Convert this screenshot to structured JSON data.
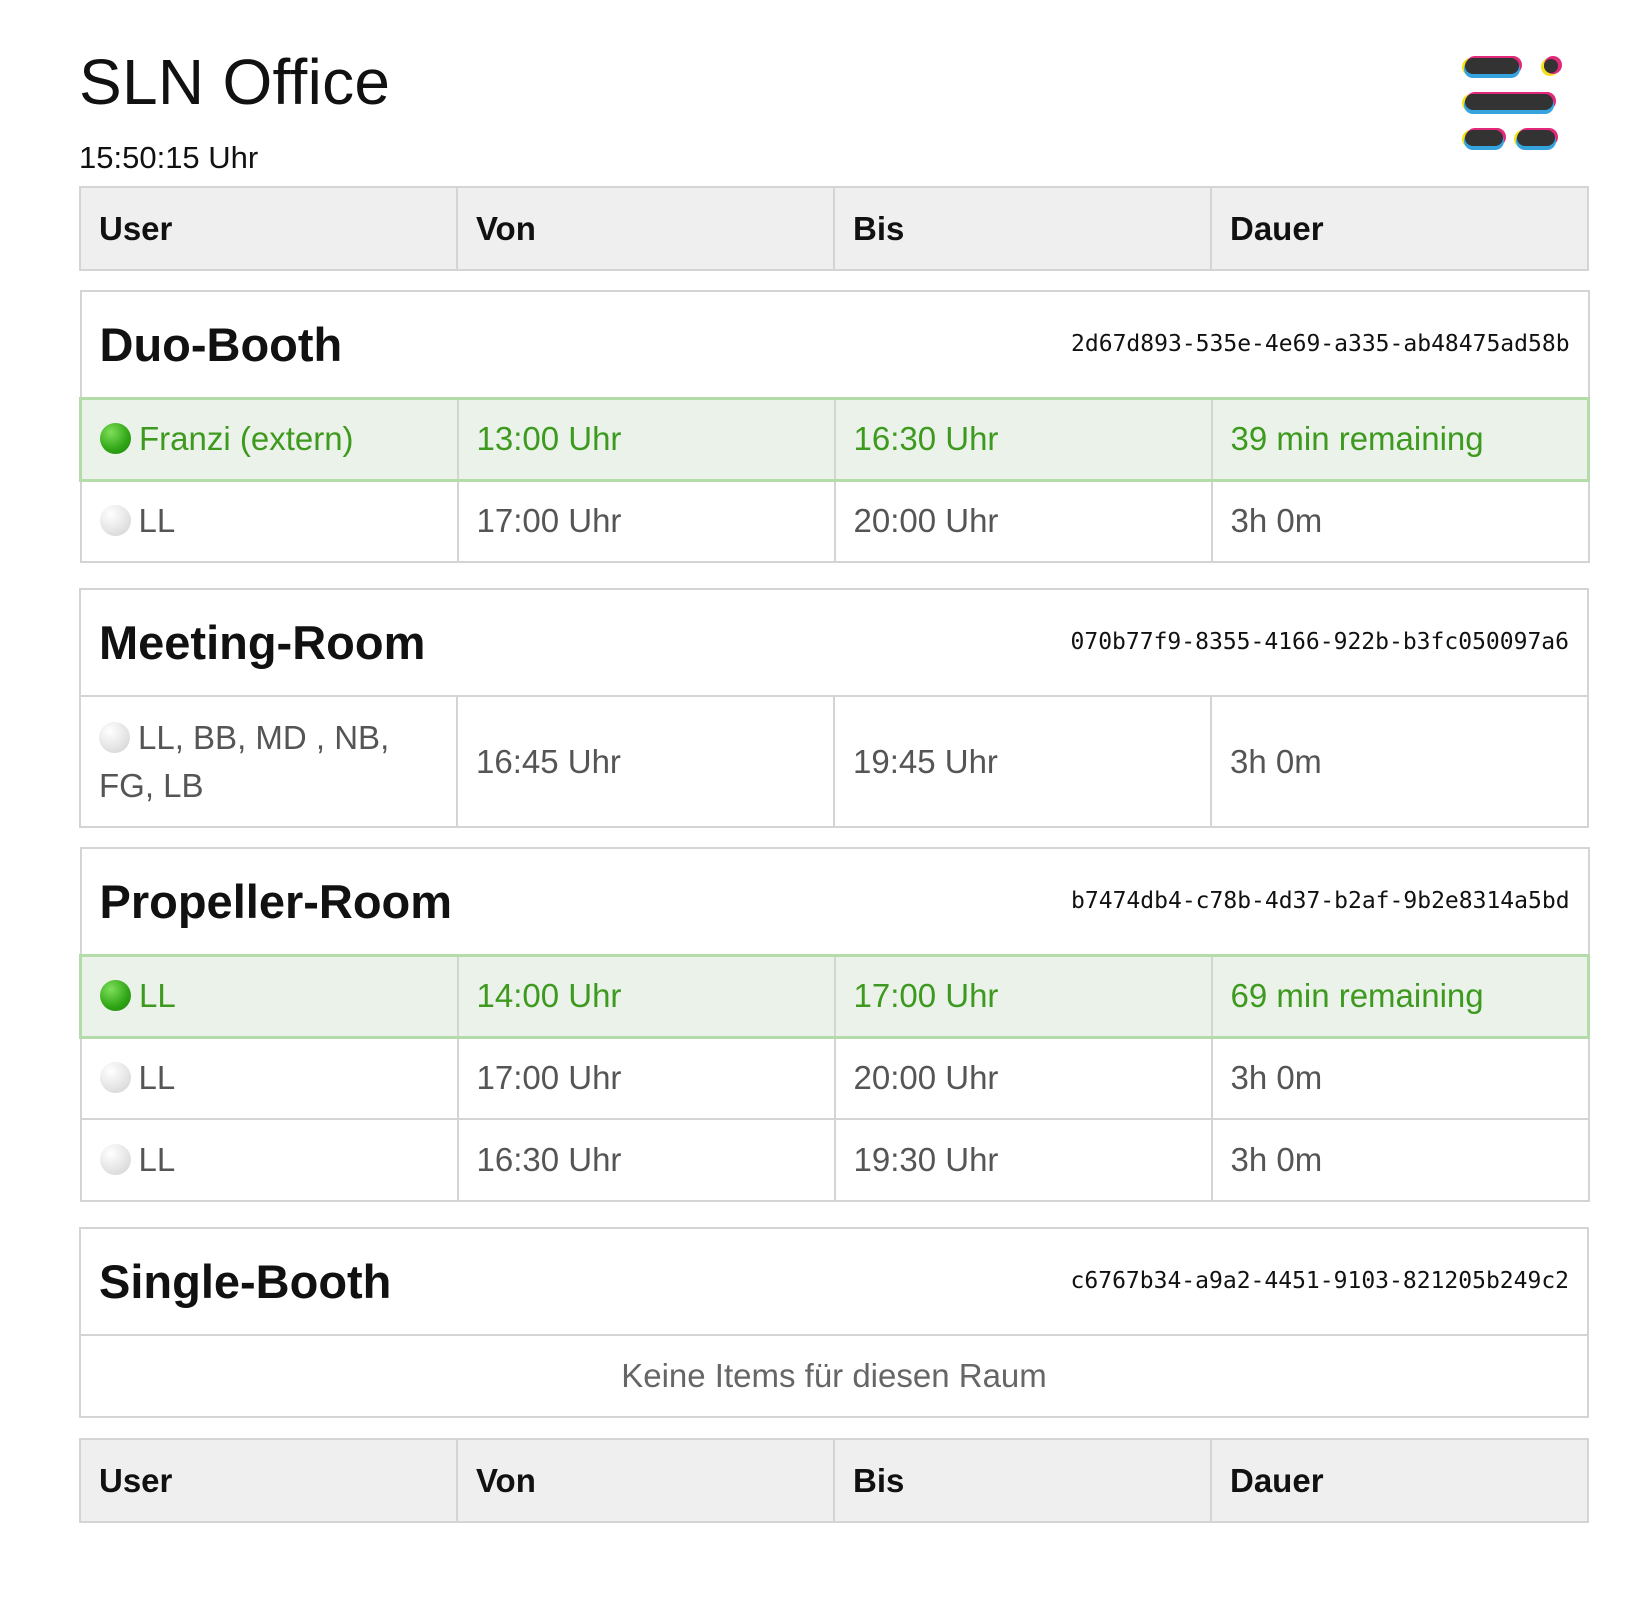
{
  "app": {
    "title": "SLN Office",
    "clock": "15:50:15 Uhr"
  },
  "logo": {
    "icon": "sln-logo-icon"
  },
  "columns": [
    "User",
    "Von",
    "Bis",
    "Dauer"
  ],
  "colors": {
    "active": "#3d9a1f",
    "active_bg": "#ebf2ea",
    "active_border": "#b4dcab"
  },
  "rooms": [
    {
      "name": "Duo-Booth",
      "id": "2d67d893-535e-4e69-a335-ab48475ad58b",
      "bookings": [
        {
          "status": "active",
          "user": "Franzi (extern)",
          "from": "13:00 Uhr",
          "to": "16:30 Uhr",
          "duration": "39 min remaining"
        },
        {
          "status": "upcoming",
          "user": "LL",
          "from": "17:00 Uhr",
          "to": "20:00 Uhr",
          "duration": "3h 0m"
        }
      ]
    },
    {
      "name": "Meeting-Room",
      "id": "070b77f9-8355-4166-922b-b3fc050097a6",
      "bookings": [
        {
          "status": "upcoming",
          "user": "LL, BB, MD , NB, FG, LB",
          "from": "16:45 Uhr",
          "to": "19:45 Uhr",
          "duration": "3h 0m"
        }
      ]
    },
    {
      "name": "Propeller-Room",
      "id": "b7474db4-c78b-4d37-b2af-9b2e8314a5bd",
      "bookings": [
        {
          "status": "active",
          "user": "LL",
          "from": "14:00 Uhr",
          "to": "17:00 Uhr",
          "duration": "69 min remaining"
        },
        {
          "status": "upcoming",
          "user": "LL",
          "from": "17:00 Uhr",
          "to": "20:00 Uhr",
          "duration": "3h 0m"
        },
        {
          "status": "upcoming",
          "user": "LL",
          "from": "16:30 Uhr",
          "to": "19:30 Uhr",
          "duration": "3h 0m"
        }
      ]
    },
    {
      "name": "Single-Booth",
      "id": "c6767b34-a9a2-4451-9103-821205b249c2",
      "bookings": [],
      "empty_text": "Keine Items für diesen Raum"
    }
  ]
}
